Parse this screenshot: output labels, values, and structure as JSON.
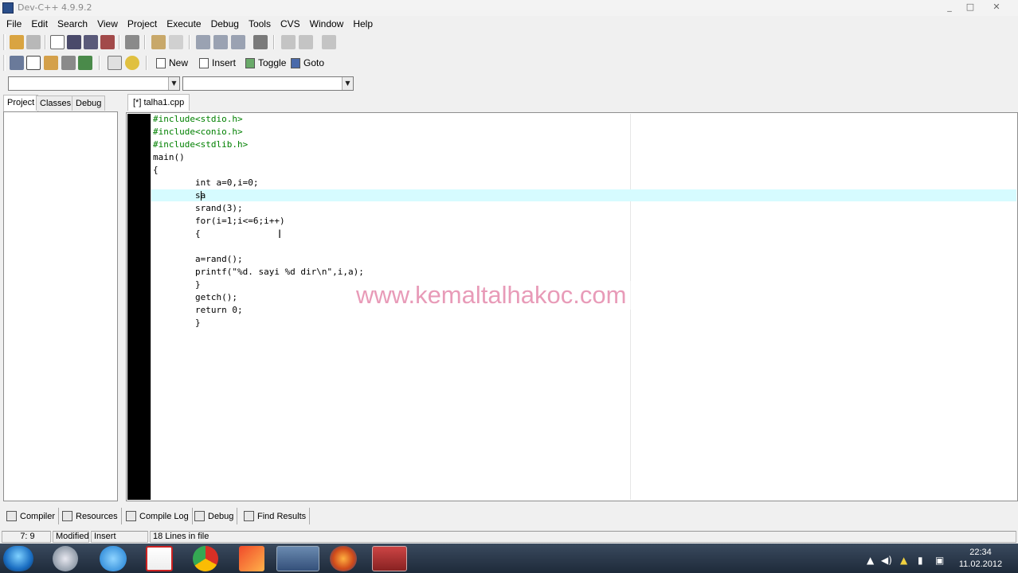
{
  "window": {
    "title": "Dev-C++ 4.9.9.2",
    "minimize": "_",
    "maximize": "□",
    "close": "✕"
  },
  "menu": [
    "File",
    "Edit",
    "Search",
    "View",
    "Project",
    "Execute",
    "Debug",
    "Tools",
    "CVS",
    "Window",
    "Help"
  ],
  "toolbar2": {
    "new": "New",
    "insert": "Insert",
    "toggle": "Toggle",
    "goto": "Goto"
  },
  "left_tabs": [
    "Project",
    "Classes",
    "Debug"
  ],
  "file_tab": "[*] talha1.cpp",
  "code_lines": [
    "#include<stdio.h>",
    "#include<conio.h>",
    "#include<stdlib.h>",
    "main()",
    "{",
    "        int a=0,i=0;",
    "        sa",
    "        srand(3);",
    "        for(i=1;i<=6;i++)",
    "        {",
    "",
    "        a=rand();",
    "        printf(\"%d. sayi %d dir\\n\",i,a);",
    "        }",
    "        getch();",
    "        return 0;",
    "        }"
  ],
  "watermark": "www.kemaltalhakoc.com",
  "bottom_tabs": [
    "Compiler",
    "Resources",
    "Compile Log",
    "Debug",
    "Find Results"
  ],
  "status": {
    "position": "7: 9",
    "modified": "Modified",
    "mode": "Insert",
    "lines": "18 Lines in file"
  },
  "clock": {
    "time": "22:34",
    "date": "11.02.2012"
  },
  "colors": {
    "active_line": "#d6fbff",
    "preprocessor": "#008000",
    "string": "#cc0000",
    "number": "#6b6bd6",
    "watermark": "#e89bb8"
  }
}
